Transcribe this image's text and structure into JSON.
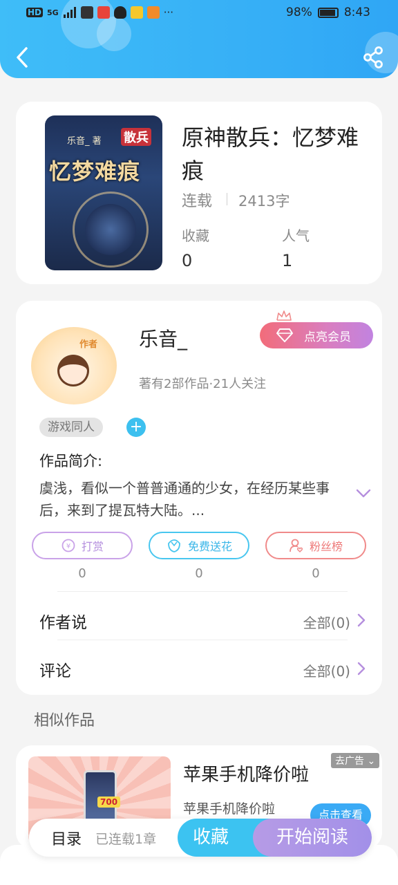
{
  "status_bar": {
    "left_text": "HD",
    "signal": "5G",
    "battery": "98%",
    "time": "8:43",
    "more": "···"
  },
  "book": {
    "title": "原神散兵：忆梦难痕",
    "status": "连载",
    "words": "2413字",
    "stats": [
      {
        "label": "收藏",
        "value": "0"
      },
      {
        "label": "人气",
        "value": "1"
      }
    ],
    "cover": {
      "title": "忆梦难痕",
      "author": "乐音_",
      "badge": "散兵",
      "mark": "著"
    }
  },
  "author": {
    "name": "乐音_",
    "meta": "著有2部作品·21人关注",
    "avatar_tag": "作者",
    "vip_label": "点亮会员",
    "genre_tag": "游戏同人",
    "add_tag": "+",
    "intro_head": "作品简介:",
    "intro_text": "虞浅，看似一个普普通通的少女，在经历某些事后，来到了提瓦特大陆。...",
    "actions": [
      {
        "label": "打赏",
        "count": "0",
        "icon": "coin-icon",
        "color": "#c9a2e8"
      },
      {
        "label": "免费送花",
        "count": "0",
        "icon": "flower-icon",
        "color": "#48c6ef"
      },
      {
        "label": "粉丝榜",
        "count": "0",
        "icon": "fan-icon",
        "color": "#f08a8a"
      }
    ],
    "rows": [
      {
        "label": "作者说",
        "value": "全部(0)"
      },
      {
        "label": "评论",
        "value": "全部(0)"
      }
    ]
  },
  "similar": {
    "title": "相似作品"
  },
  "ad": {
    "title": "苹果手机降价啦",
    "subtitle": "苹果手机降价啦",
    "mark": "去广告",
    "button": "点击查看",
    "price": "700"
  },
  "bottom_bar": {
    "toc": "目录",
    "chapters": "已连载1章",
    "favorite": "收藏",
    "read": "开始阅读"
  },
  "colors": {
    "header": "#38b4f6",
    "accent_blue": "#3cc3f1",
    "accent_purple": "#a892e8"
  }
}
